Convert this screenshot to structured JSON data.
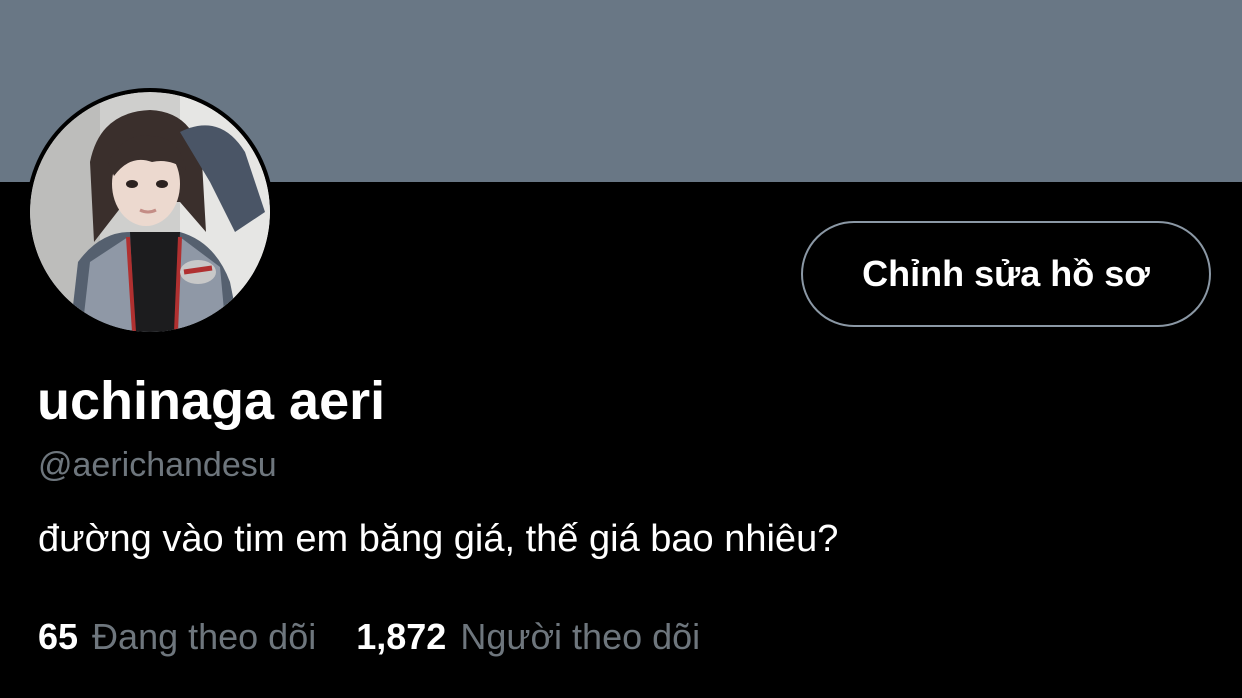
{
  "profile": {
    "banner_color": "#697785",
    "avatar_icon": "profile-photo",
    "display_name": "uchinaga aeri",
    "handle": "@aerichandesu",
    "bio": "đường vào tim em băng giá, thế giá bao nhiêu?",
    "edit_button_label": "Chỉnh sửa hồ sơ",
    "following_count": "65",
    "following_label": "Đang theo dõi",
    "followers_count": "1,872",
    "followers_label": "Người theo dõi"
  },
  "colors": {
    "background": "#000000",
    "text_primary": "#ffffff",
    "text_secondary": "#6e767d",
    "button_border": "#8b98a5"
  }
}
